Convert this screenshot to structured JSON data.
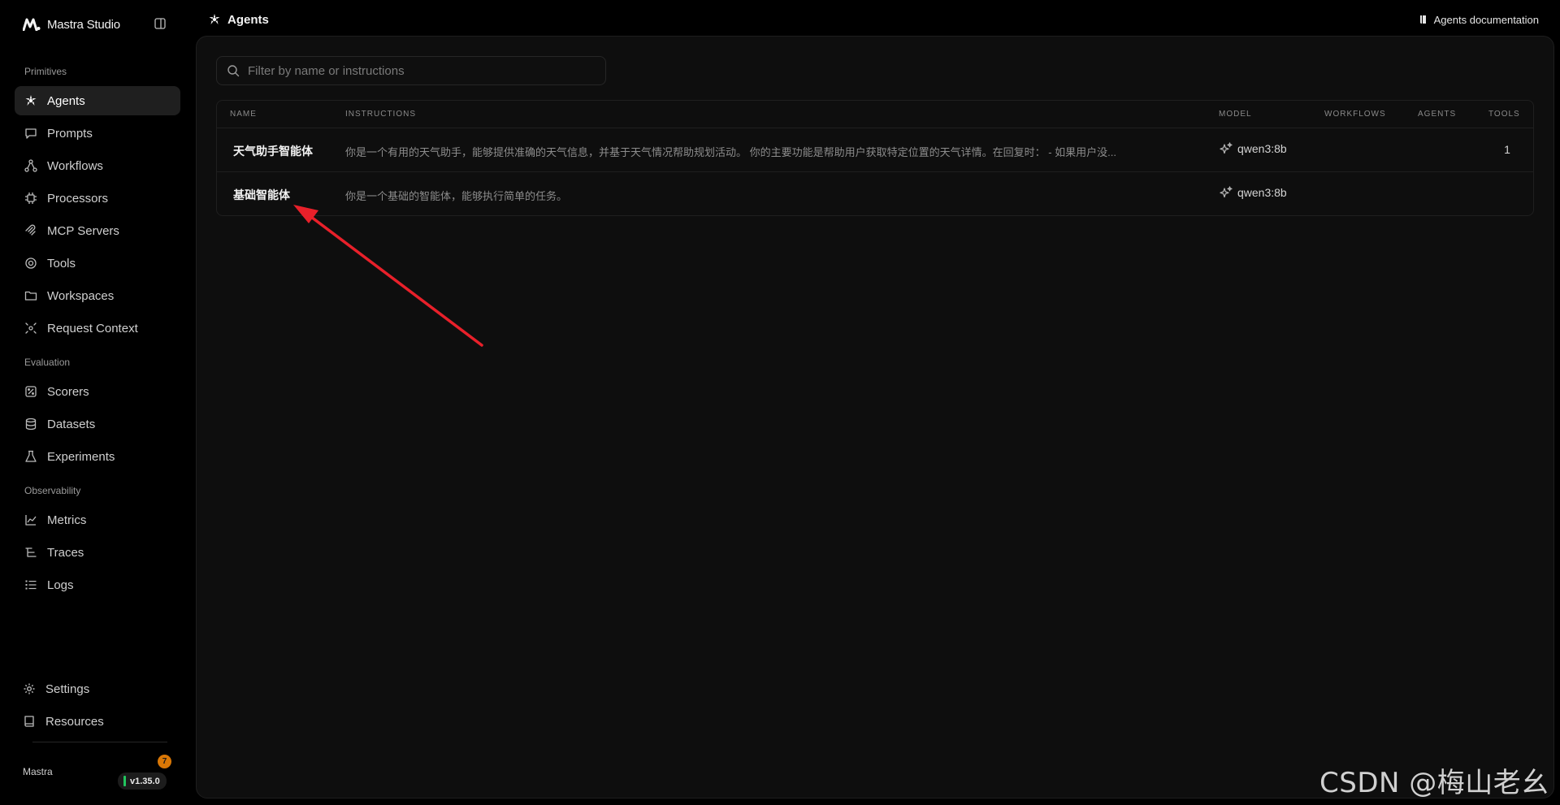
{
  "brand": {
    "name": "Mastra Studio"
  },
  "sidebar": {
    "sections": [
      {
        "label": "Primitives"
      },
      {
        "label": "Evaluation"
      },
      {
        "label": "Observability"
      }
    ],
    "items": [
      {
        "label": "Agents",
        "icon": "agents-icon",
        "active": true
      },
      {
        "label": "Prompts",
        "icon": "prompts-icon"
      },
      {
        "label": "Workflows",
        "icon": "workflows-icon"
      },
      {
        "label": "Processors",
        "icon": "processors-icon"
      },
      {
        "label": "MCP Servers",
        "icon": "mcp-icon"
      },
      {
        "label": "Tools",
        "icon": "tools-icon"
      },
      {
        "label": "Workspaces",
        "icon": "folder-icon"
      },
      {
        "label": "Request Context",
        "icon": "request-context-icon"
      },
      {
        "label": "Scorers",
        "icon": "scorers-icon"
      },
      {
        "label": "Datasets",
        "icon": "database-icon"
      },
      {
        "label": "Experiments",
        "icon": "flask-icon"
      },
      {
        "label": "Metrics",
        "icon": "chart-icon"
      },
      {
        "label": "Traces",
        "icon": "traces-icon"
      },
      {
        "label": "Logs",
        "icon": "list-icon"
      }
    ],
    "footer": {
      "settings": "Settings",
      "resources": "Resources",
      "org": "Mastra",
      "version": "v1.35.0",
      "notifications": "7"
    }
  },
  "header": {
    "title": "Agents",
    "docs_link": "Agents documentation"
  },
  "search": {
    "placeholder": "Filter by name or instructions",
    "value": ""
  },
  "table": {
    "columns": [
      "NAME",
      "INSTRUCTIONS",
      "MODEL",
      "WORKFLOWS",
      "AGENTS",
      "TOOLS"
    ],
    "rows": [
      {
        "name": "天气助手智能体",
        "instructions": "你是一个有用的天气助手，能够提供准确的天气信息，并基于天气情况帮助规划活动。 你的主要功能是帮助用户获取特定位置的天气详情。在回复时： - 如果用户没...",
        "model": "qwen3:8b",
        "workflows": "",
        "agents": "",
        "tools": "1"
      },
      {
        "name": "基础智能体",
        "instructions": "你是一个基础的智能体，能够执行简单的任务。",
        "model": "qwen3:8b",
        "workflows": "",
        "agents": "",
        "tools": ""
      }
    ]
  },
  "colors": {
    "accent_arrow": "#e8202a",
    "status_green": "#22c55e",
    "badge_orange": "#d97706"
  },
  "watermark": "CSDN @梅山老幺"
}
